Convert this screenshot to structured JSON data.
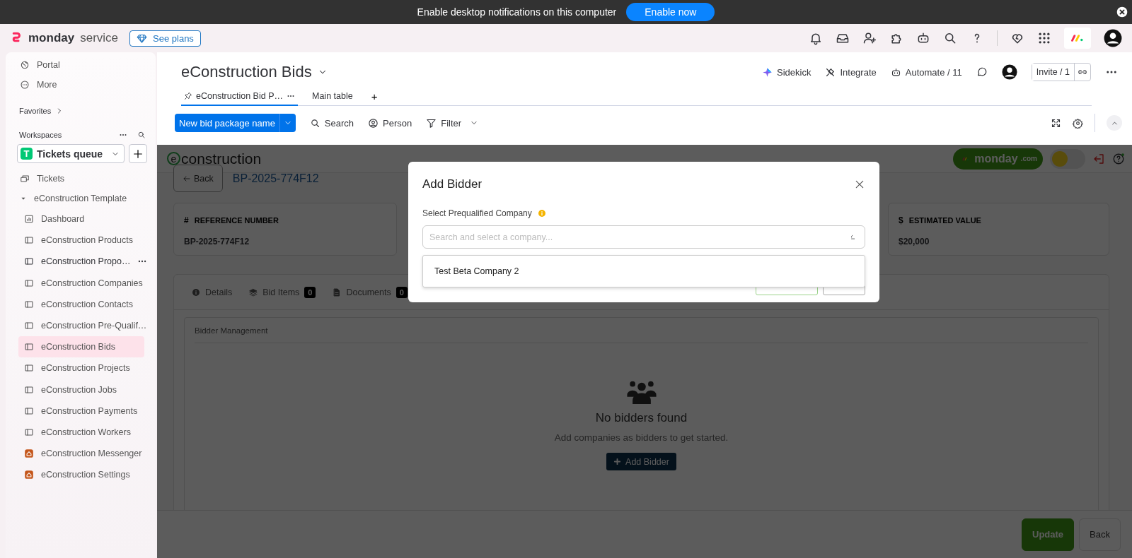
{
  "notification_bar": {
    "message": "Enable desktop notifications on this computer",
    "button": "Enable now"
  },
  "top_nav": {
    "brand": "monday",
    "product": "service",
    "plans_button": "See plans"
  },
  "sidebar": {
    "items": [
      {
        "label": "Portal"
      },
      {
        "label": "More"
      }
    ],
    "favorites": "Favorites",
    "workspaces": "Workspaces",
    "workspace": {
      "initial": "T",
      "name": "Tickets queue"
    },
    "tree": [
      {
        "label": "Tickets",
        "kind": "tickets",
        "selected": false,
        "hovered": false
      },
      {
        "label": "eConstruction Template",
        "kind": "folder",
        "expanded": true,
        "selected": false,
        "hovered": false,
        "children": [
          {
            "label": "Dashboard",
            "kind": "dashboard",
            "selected": false,
            "hovered": false
          },
          {
            "label": "eConstruction Products",
            "kind": "board",
            "selected": false,
            "hovered": false
          },
          {
            "label": "eConstruction Propo…",
            "kind": "board",
            "selected": false,
            "hovered": true
          },
          {
            "label": "eConstruction Companies",
            "kind": "board",
            "selected": false,
            "hovered": false
          },
          {
            "label": "eConstruction Contacts",
            "kind": "board",
            "selected": false,
            "hovered": false
          },
          {
            "label": "eConstruction Pre-Qualif…",
            "kind": "board",
            "selected": false,
            "hovered": false
          },
          {
            "label": "eConstruction Bids",
            "kind": "board",
            "selected": true,
            "hovered": false
          },
          {
            "label": "eConstruction Projects",
            "kind": "board",
            "selected": false,
            "hovered": false
          },
          {
            "label": "eConstruction Jobs",
            "kind": "board",
            "selected": false,
            "hovered": false
          },
          {
            "label": "eConstruction Payments",
            "kind": "board",
            "selected": false,
            "hovered": false
          },
          {
            "label": "eConstruction Workers",
            "kind": "board",
            "selected": false,
            "hovered": false
          },
          {
            "label": "eConstruction Messenger",
            "kind": "app",
            "selected": false,
            "hovered": false
          },
          {
            "label": "eConstruction Settings",
            "kind": "app",
            "selected": false,
            "hovered": false
          }
        ]
      }
    ]
  },
  "board_header": {
    "title": "eConstruction Bids",
    "actions": [
      {
        "label": "Sidekick"
      },
      {
        "label": "Integrate"
      },
      {
        "label": "Automate / 11"
      }
    ],
    "invite_button": "Invite / 1",
    "views": [
      {
        "label": "eConstruction Bid P…",
        "pinned": true,
        "selected": true
      },
      {
        "label": "Main table",
        "pinned": false,
        "selected": false
      }
    ],
    "add_view": "+"
  },
  "toolbar": {
    "primary_button": "New bid package name",
    "tools": [
      {
        "label": "Search"
      },
      {
        "label": "Person"
      },
      {
        "label": "Filter"
      }
    ]
  },
  "app": {
    "logo_mark": "e",
    "logo_text": "construction",
    "monday_badge": {
      "name": "monday",
      "suffix": ".com"
    },
    "theme_toggle": {
      "on": false
    },
    "back_button": "Back",
    "reference": "BP-2025-774F12",
    "cards": [
      {
        "symbol": "#",
        "label": "REFERENCE NUMBER",
        "value": "BP-2025-774F12"
      },
      {
        "symbol": "$",
        "label": "ESTIMATED VALUE",
        "value": "$20,000"
      }
    ],
    "tabs": [
      {
        "label": "Details"
      },
      {
        "label": "Bid Items",
        "badge": "0"
      },
      {
        "label": "Documents",
        "badge": "0"
      }
    ],
    "panel": {
      "title": "Bidder Management",
      "empty_title": "No bidders found",
      "empty_text": "Add companies as bidders to get started.",
      "button": "Add Bidder"
    },
    "footer": [
      {
        "label": "Update",
        "kind": "primary"
      },
      {
        "label": "Back",
        "kind": "secondary"
      }
    ]
  },
  "modal": {
    "title": "Add Bidder",
    "field_label": "Select Prequalified Company",
    "placeholder": "Search and select a company...",
    "options": [
      {
        "label": "Test Beta Company 2",
        "selected": false
      }
    ]
  }
}
